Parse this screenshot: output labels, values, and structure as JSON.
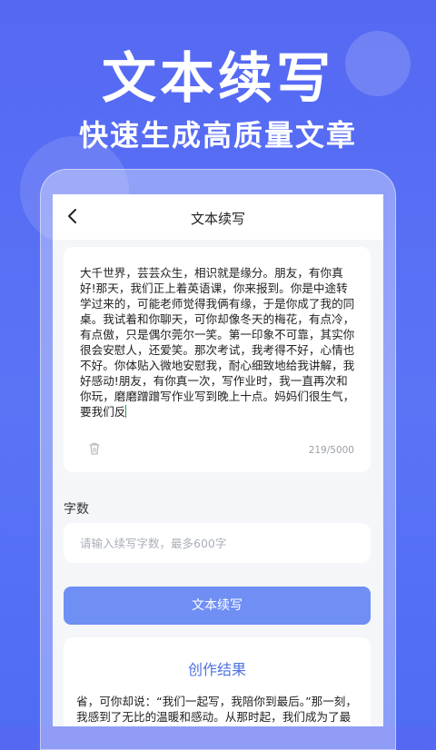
{
  "hero": {
    "title": "文本续写",
    "subtitle": "快速生成高质量文章"
  },
  "nav": {
    "title": "文本续写",
    "back_icon": "chevron-left-icon"
  },
  "editor": {
    "text": "大千世界，芸芸众生，相识就是缘分。朋友，有你真好!那天，我们正上着英语课，你来报到。你是中途转学过来的，可能老师觉得我俩有缘，于是你成了我的同桌。我试着和你聊天，可你却像冬天的梅花，有点冷，有点傲，只是偶尔莞尔一笑。第一印象不可靠，其实你很会安慰人，还爱笑。那次考试，我考得不好，心情也不好。你体贴入微地安慰我，耐心细致地给我讲解，我好感动!朋友，有你真一次，写作业时，我一直再次和你玩，磨磨蹭蹭写作业写到晚上十点。妈妈们很生气，要我们反",
    "char_count": "219/5000",
    "trash_icon": "trash-icon"
  },
  "word_count": {
    "label": "字数",
    "placeholder": "请输入续写字数，最多600字",
    "value": ""
  },
  "action": {
    "button_label": "文本续写"
  },
  "result": {
    "title": "创作结果",
    "text": "省，可你却说：“我们一起写，我陪你到最后。”那一刻，我感到了无比的温暖和感动。从那时起，我们成为了最好的朋友，我们一起上课，一起放学，一起吃饭"
  },
  "colors": {
    "background": "#5568f2",
    "button": "#6f8ff5",
    "result_title": "#4e72e0",
    "caret": "#16a34a"
  }
}
